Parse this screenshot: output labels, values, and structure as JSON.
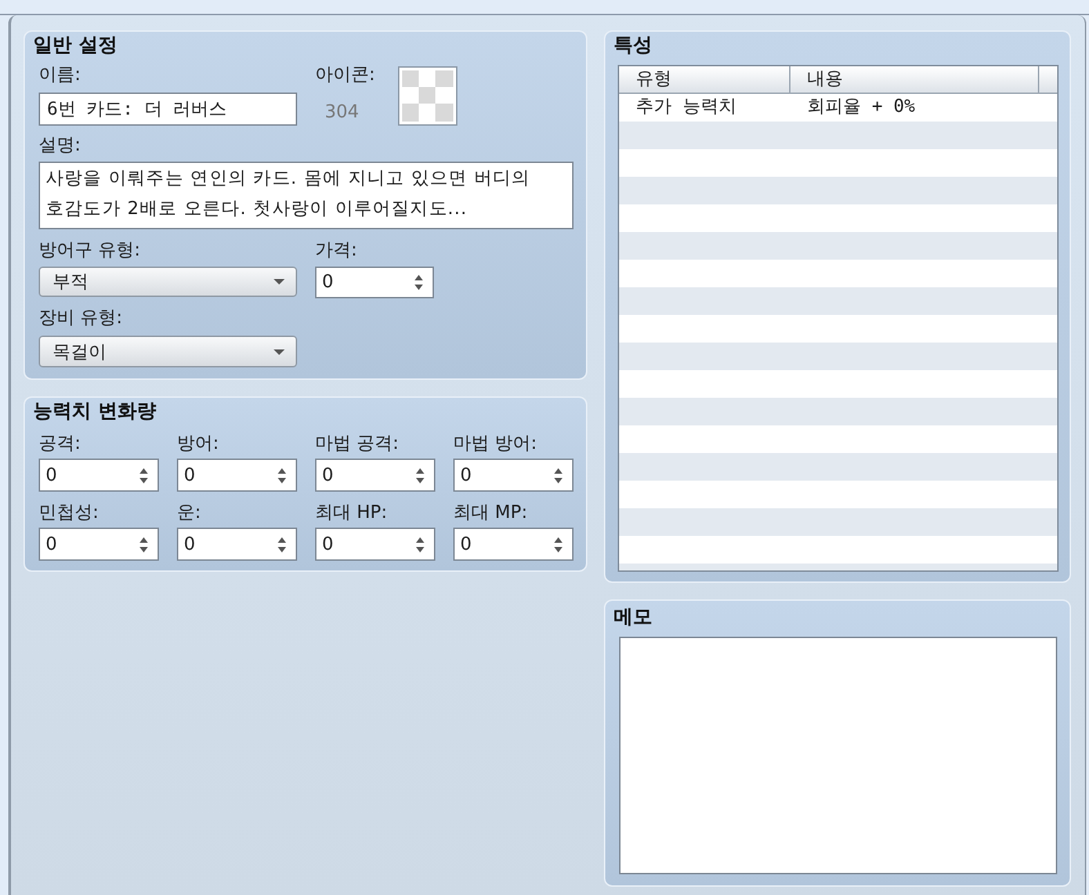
{
  "general_settings": {
    "title": "일반 설정",
    "name": {
      "label": "이름:",
      "value": "6번 카드: 더 러버스"
    },
    "icon": {
      "label": "아이콘:",
      "index": "304"
    },
    "description": {
      "label": "설명:",
      "value": "사랑을 이뤄주는 연인의 카드. 몸에 지니고 있으면 버디의 호감도가 2배로 오른다. 첫사랑이 이루어질지도..."
    },
    "armor_type": {
      "label": "방어구 유형:",
      "value": "부적"
    },
    "price": {
      "label": "가격:",
      "value": "0"
    },
    "equipment_type": {
      "label": "장비 유형:",
      "value": "목걸이"
    }
  },
  "parameter_changes": {
    "title": "능력치 변화량",
    "fields": [
      {
        "label": "공격:",
        "value": "0"
      },
      {
        "label": "방어:",
        "value": "0"
      },
      {
        "label": "마법 공격:",
        "value": "0"
      },
      {
        "label": "마법 방어:",
        "value": "0"
      },
      {
        "label": "민첩성:",
        "value": "0"
      },
      {
        "label": "운:",
        "value": "0"
      },
      {
        "label": "최대 HP:",
        "value": "0"
      },
      {
        "label": "최대 MP:",
        "value": "0"
      }
    ]
  },
  "traits": {
    "title": "특성",
    "columns": [
      "유형",
      "내용"
    ],
    "rows": [
      {
        "type": "추가 능력치",
        "content": "회피율 + 0%"
      }
    ]
  },
  "memo": {
    "title": "메모"
  }
}
